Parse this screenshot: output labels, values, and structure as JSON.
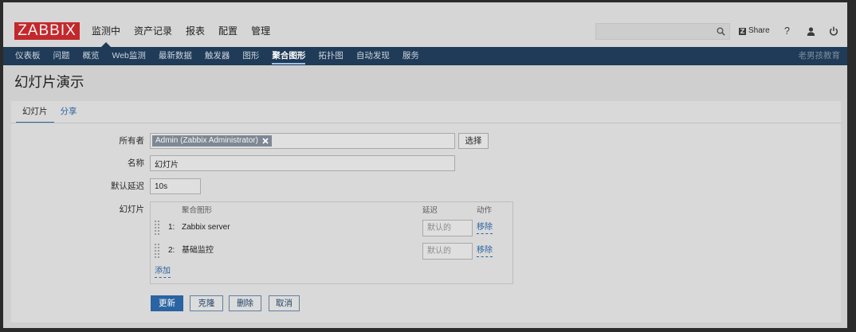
{
  "colors": {
    "frame": "#2b2b2b",
    "header_bg": "#d6d6d6",
    "subnav_bg": "#1f3b58",
    "page_bg": "#cfcfcf",
    "card_bg": "#d9d9d9",
    "logo_red": "#c3282c",
    "link": "#2b63a0",
    "primary": "#2a64a2"
  },
  "icons": {
    "search": "search-icon",
    "user": "user-icon",
    "power": "power-icon",
    "drag": "drag-handle-icon",
    "token_remove": "remove-token-icon"
  },
  "header": {
    "logo": "ZABBIX",
    "menu": [
      {
        "label": "监测中",
        "active": true
      },
      {
        "label": "资产记录"
      },
      {
        "label": "报表"
      },
      {
        "label": "配置"
      },
      {
        "label": "管理"
      }
    ],
    "share": {
      "badge": "Z",
      "label": "Share"
    },
    "help": "?"
  },
  "subnav": {
    "items": [
      {
        "label": "仪表板"
      },
      {
        "label": "问题"
      },
      {
        "label": "概览"
      },
      {
        "label": "Web监测"
      },
      {
        "label": "最新数据"
      },
      {
        "label": "触发器"
      },
      {
        "label": "图形"
      },
      {
        "label": "聚合图形",
        "active": true
      },
      {
        "label": "拓扑图"
      },
      {
        "label": "自动发现"
      },
      {
        "label": "服务"
      }
    ],
    "right_text": "老男孩教育"
  },
  "page": {
    "title": "幻灯片演示"
  },
  "tabs": [
    {
      "label": "幻灯片",
      "active": true
    },
    {
      "label": "分享"
    }
  ],
  "form": {
    "owner": {
      "label": "所有者",
      "selected": "Admin (Zabbix Administrator)",
      "select_button": "选择"
    },
    "name": {
      "label": "名称",
      "value": "幻灯片"
    },
    "delay": {
      "label": "默认延迟",
      "value": "10s"
    },
    "slides": {
      "label": "幻灯片",
      "columns": {
        "screen": "聚合图形",
        "delay": "延迟",
        "action": "动作"
      },
      "rows": [
        {
          "index": "1:",
          "screen": "Zabbix server",
          "delay_placeholder": "默认的",
          "action": "移除"
        },
        {
          "index": "2:",
          "screen": "基础监控",
          "delay_placeholder": "默认的",
          "action": "移除"
        }
      ],
      "add": "添加"
    },
    "buttons": {
      "update": "更新",
      "clone": "克隆",
      "delete": "删除",
      "cancel": "取消"
    }
  }
}
